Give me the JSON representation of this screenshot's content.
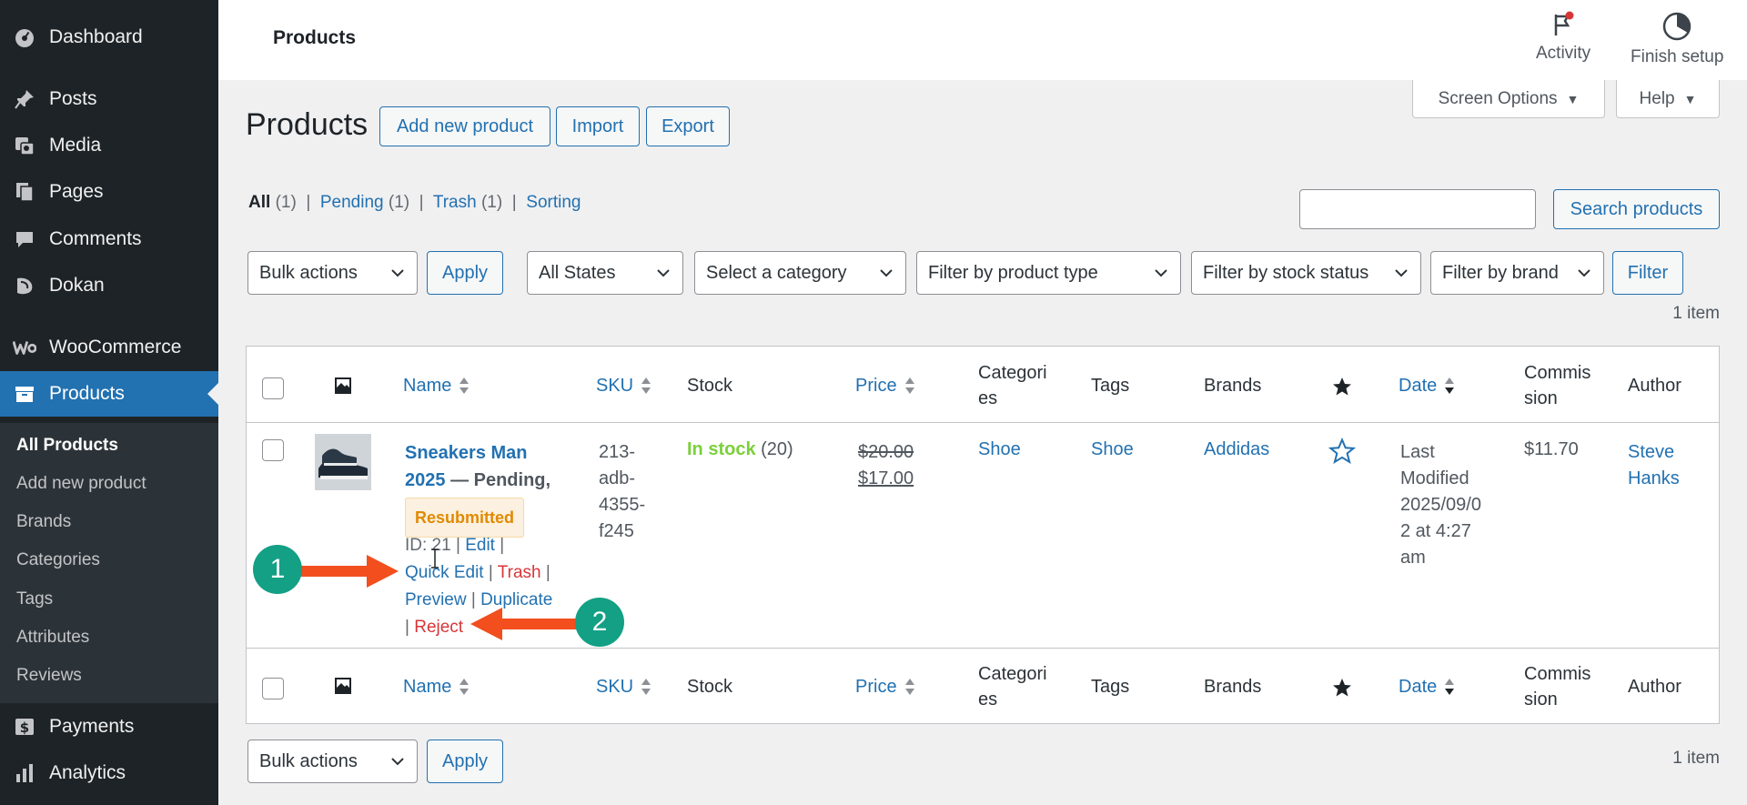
{
  "sidebar": {
    "items": [
      {
        "label": "Dashboard",
        "icon": "dashboard-icon"
      },
      {
        "label": "Posts",
        "icon": "pin-icon"
      },
      {
        "label": "Media",
        "icon": "media-icon"
      },
      {
        "label": "Pages",
        "icon": "pages-icon"
      },
      {
        "label": "Comments",
        "icon": "comment-icon"
      },
      {
        "label": "Dokan",
        "icon": "dokan-icon"
      },
      {
        "label": "WooCommerce",
        "icon": "woocommerce-icon"
      },
      {
        "label": "Products",
        "icon": "archive-icon"
      },
      {
        "label": "Payments",
        "icon": "dollar-icon"
      },
      {
        "label": "Analytics",
        "icon": "bar-chart-icon"
      }
    ],
    "submenu": [
      "All Products",
      "Add new product",
      "Brands",
      "Categories",
      "Tags",
      "Attributes",
      "Reviews"
    ]
  },
  "topbar": {
    "title": "Products",
    "activity": "Activity",
    "finish_setup": "Finish setup"
  },
  "screen_options": "Screen Options",
  "help": "Help",
  "page": {
    "title": "Products",
    "add_new": "Add new product",
    "import": "Import",
    "export": "Export"
  },
  "views": {
    "all": "All",
    "all_count": "(1)",
    "pending": "Pending",
    "pending_count": "(1)",
    "trash": "Trash",
    "trash_count": "(1)",
    "sorting": "Sorting"
  },
  "search": {
    "button": "Search products"
  },
  "filters": {
    "bulk_actions": "Bulk actions",
    "apply": "Apply",
    "states": "All States",
    "category": "Select a category",
    "product_type": "Filter by product type",
    "stock_status": "Filter by stock status",
    "brand": "Filter by brand",
    "filter": "Filter",
    "count": "1 item"
  },
  "columns": {
    "name": "Name",
    "sku": "SKU",
    "stock": "Stock",
    "price": "Price",
    "categories_1": "Categori",
    "categories_2": "es",
    "tags": "Tags",
    "brands": "Brands",
    "date": "Date",
    "commission_1": "Commis",
    "commission_2": "sion",
    "author": "Author"
  },
  "row": {
    "name_1": "Sneakers Man",
    "name_2": "2025",
    "status": "— Pending,",
    "badge": "Resubmitted",
    "id": "ID: 21",
    "edit": "Edit",
    "quick_edit": "Quick Edit",
    "trash": "Trash",
    "preview": "Preview",
    "duplicate": "Duplicate",
    "reject": "Reject",
    "sku_lines": [
      "213-",
      "adb-",
      "4355-",
      "f245"
    ],
    "stock_label": "In stock",
    "stock_count": "(20)",
    "regular_price": "$20.00",
    "sale_price": "$17.00",
    "category": "Shoe",
    "tag": "Shoe",
    "brand": "Addidas",
    "date_lines": [
      "Last",
      "Modified",
      "2025/09/0",
      "2 at 4:27",
      "am"
    ],
    "commission": "$11.70",
    "author_1": "Steve",
    "author_2": "Hanks"
  },
  "annotations": {
    "one": "1",
    "two": "2"
  },
  "colors": {
    "accent": "#2271b1",
    "sidebar": "#1d2327",
    "instock": "#7ad03a",
    "danger": "#d63638",
    "annotation_arrow": "#f24e1e",
    "annotation_badge": "#13a085"
  }
}
